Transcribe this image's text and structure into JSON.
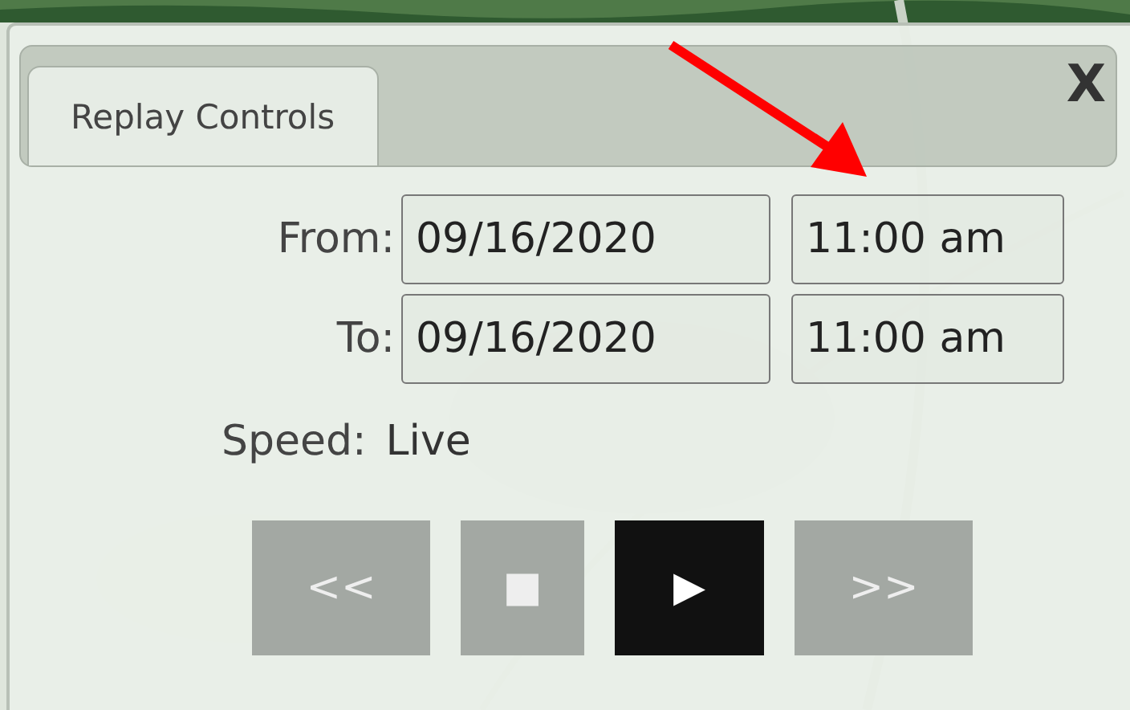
{
  "panel": {
    "tabs": [
      {
        "label": "Replay Controls",
        "selected": true
      }
    ],
    "close": "X"
  },
  "range": [
    {
      "label": "From:",
      "date": "09/16/2020",
      "time": "11:00 am"
    },
    {
      "label": "To:",
      "date": "09/16/2020",
      "time": "11:00 am"
    }
  ],
  "speed": {
    "label": "Speed:",
    "value": "Live"
  },
  "buttons": [
    {
      "kind": "rewind",
      "glyph": "<<",
      "selected": false
    },
    {
      "kind": "stop",
      "glyph": "■",
      "selected": false
    },
    {
      "kind": "play",
      "glyph": "▶",
      "selected": true
    },
    {
      "kind": "forward",
      "glyph": ">>",
      "selected": false
    }
  ],
  "annotation": {
    "kind": "arrow"
  }
}
